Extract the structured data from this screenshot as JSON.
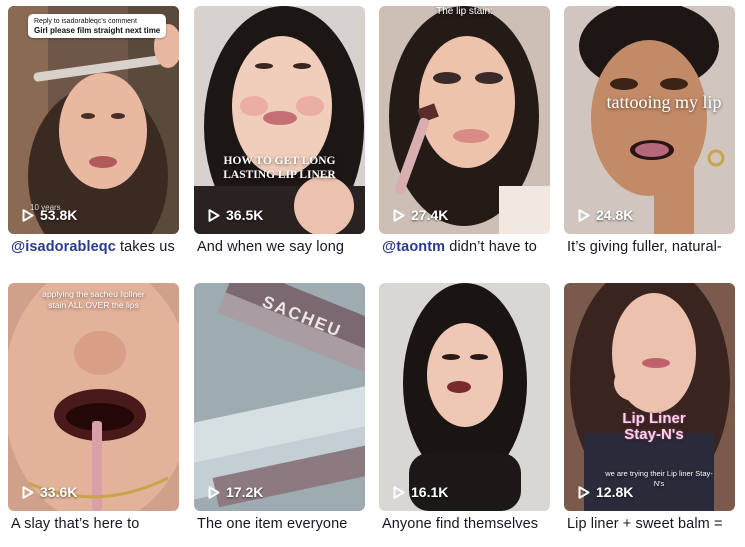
{
  "videos": [
    {
      "views": "53.8K",
      "caption_tag": "@isadorableqc",
      "caption": " takes us",
      "overlay_title": "Girl please film straight next time",
      "overlay_sub": "Reply to isadorableqc's comment",
      "overlay_bottom": "10 years"
    },
    {
      "views": "36.5K",
      "caption_tag": "",
      "caption": "And when we say long",
      "overlay_title": "HOW TO GET LONG LASTING LIP LINER"
    },
    {
      "views": "27.4K",
      "caption_tag": "@taontm",
      "caption": " didn’t have to",
      "overlay_title": "The lip stain:"
    },
    {
      "views": "24.8K",
      "caption_tag": "",
      "caption": "It’s giving fuller, natural-",
      "overlay_title": "tattooing my lip"
    },
    {
      "views": "33.6K",
      "caption_tag": "",
      "caption": "A slay that’s here to",
      "overlay_title": "applying the sacheu lipliner stain ALL OVER the lips"
    },
    {
      "views": "17.2K",
      "caption_tag": "",
      "caption": "The one item everyone",
      "overlay_title": "SACHEU"
    },
    {
      "views": "16.1K",
      "caption_tag": "",
      "caption": "Anyone find themselves",
      "overlay_title": ""
    },
    {
      "views": "12.8K",
      "caption_tag": "",
      "caption": "Lip liner + sweet balm =",
      "overlay_title": "Lip Liner Stay-N's",
      "overlay_sub": "we are trying their Lip liner Stay-N's"
    }
  ],
  "colors": {
    "caption": "#161823",
    "mention": "#2b3a8f"
  },
  "icons": {
    "views": "play-icon"
  }
}
